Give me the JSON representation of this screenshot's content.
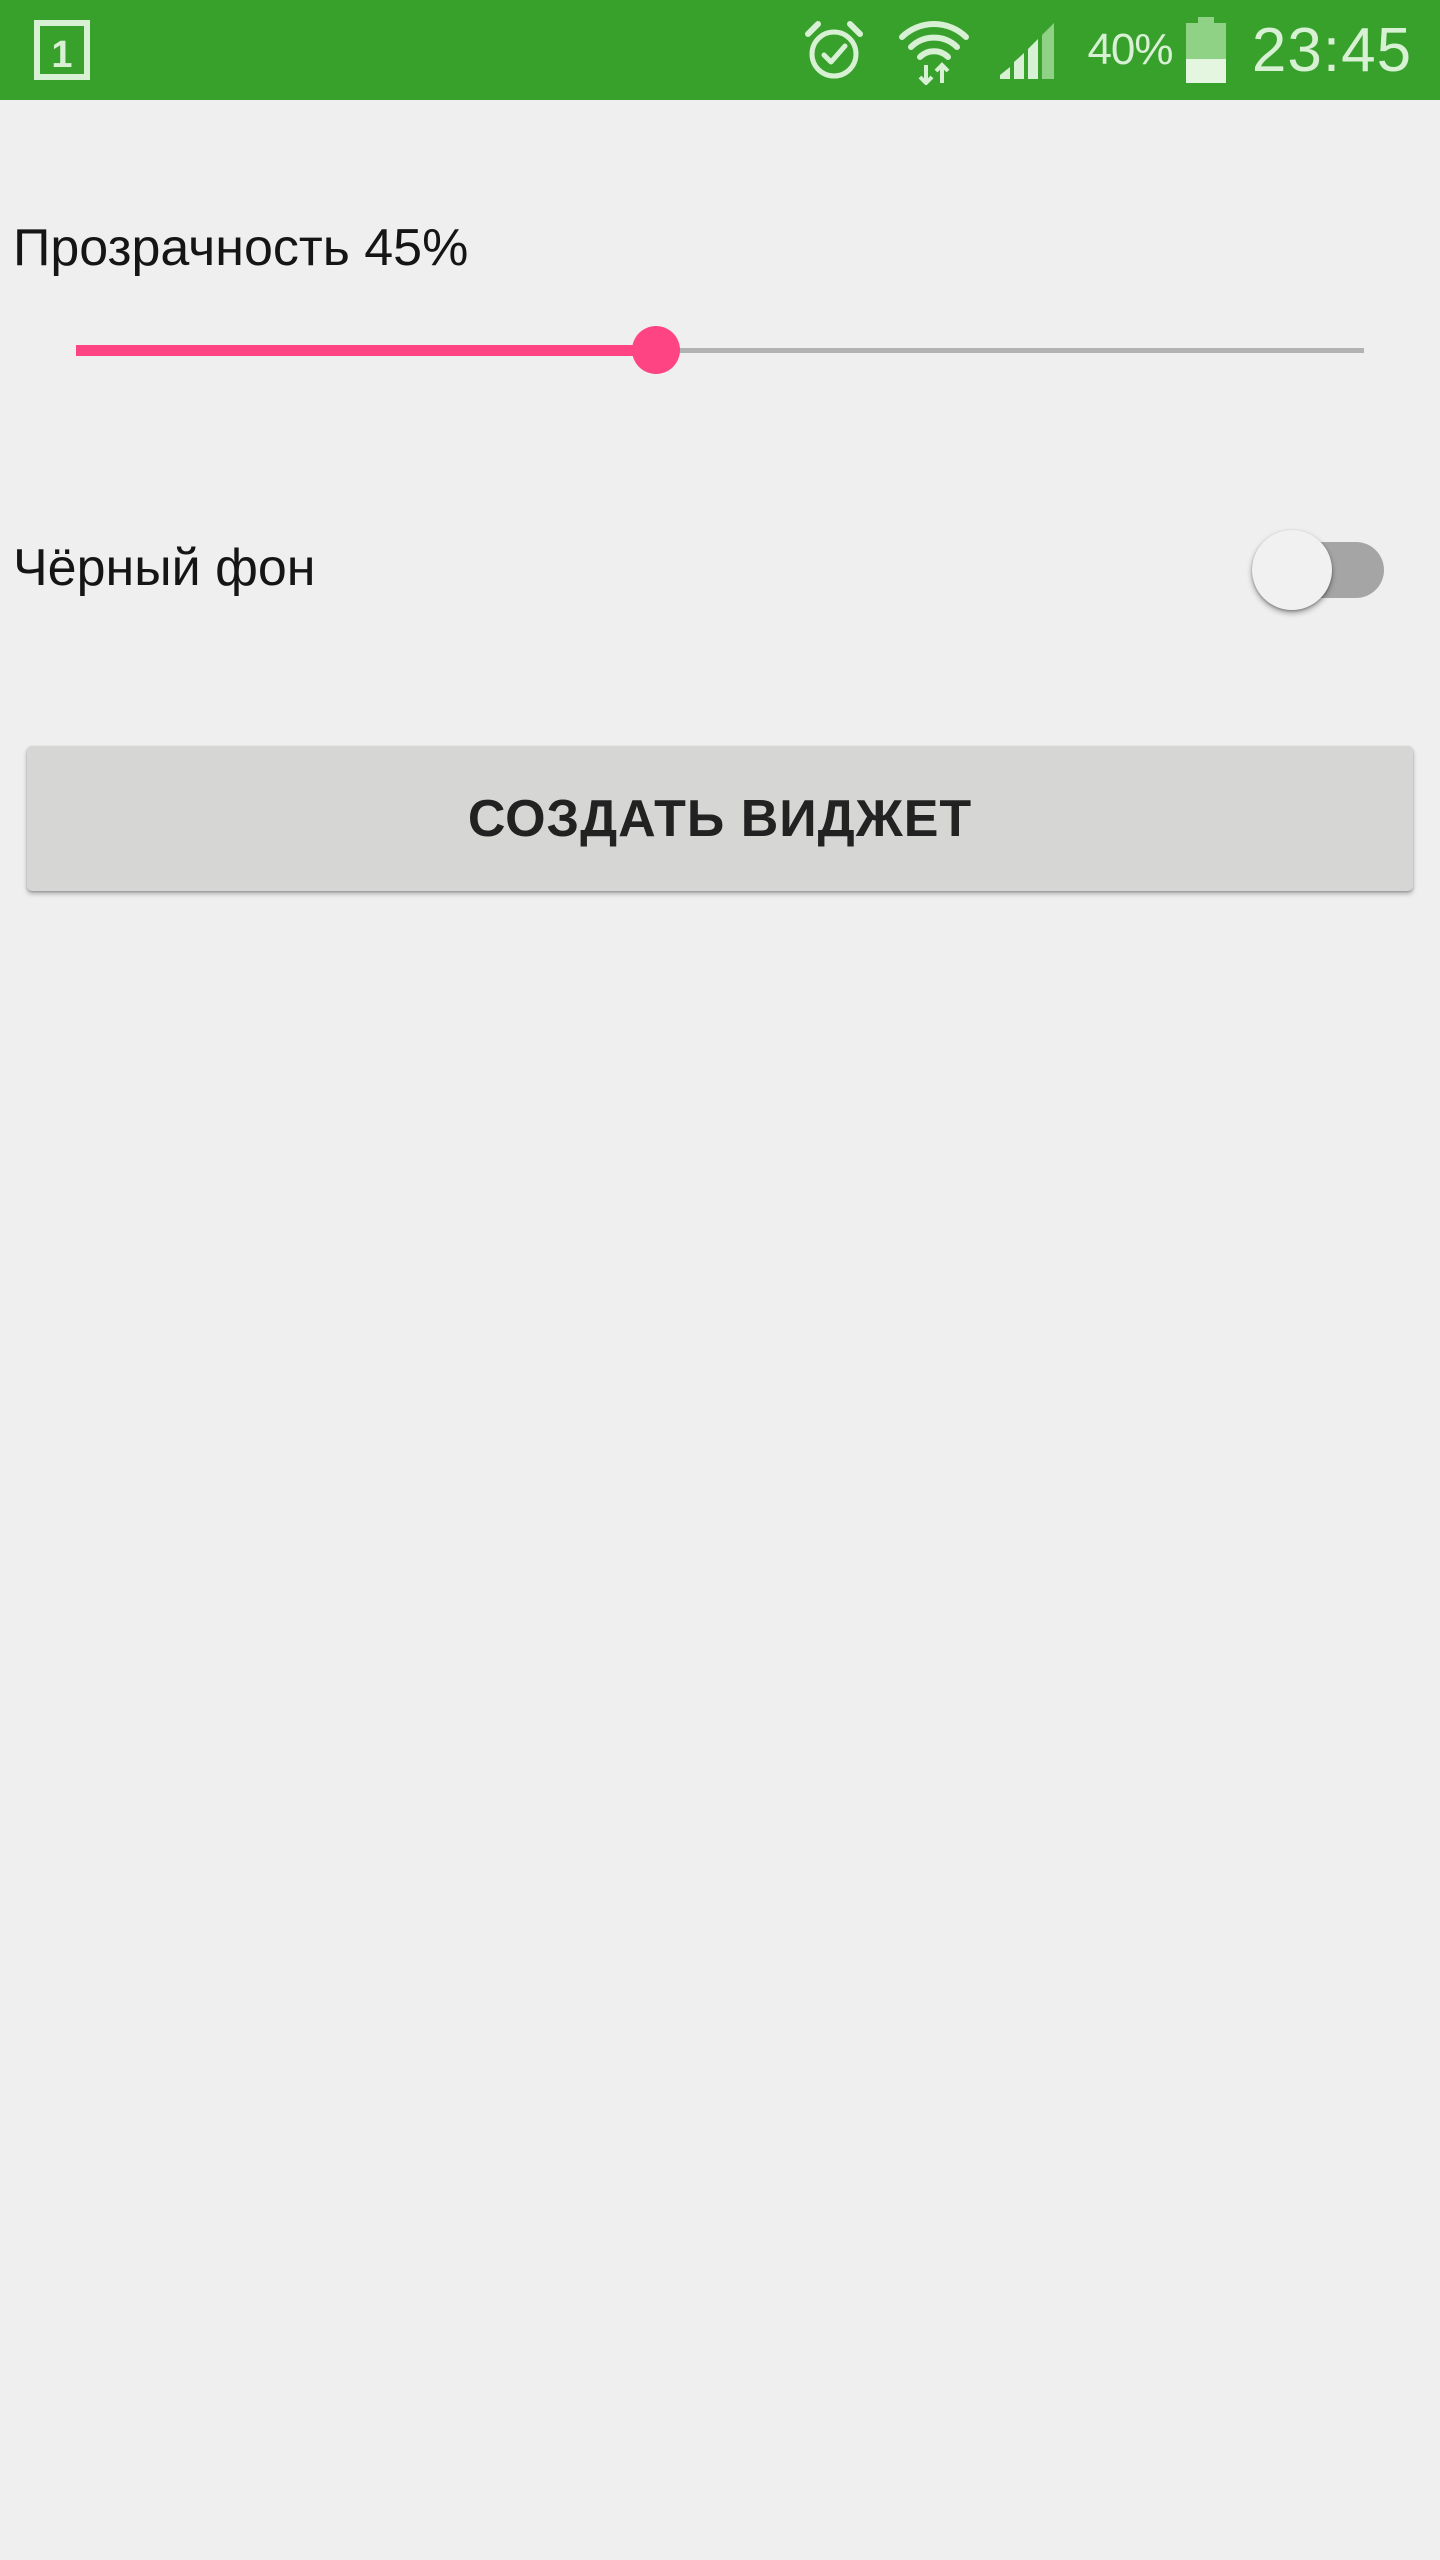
{
  "status_bar": {
    "background_color": "#37a12c",
    "icons": [
      "calendar-icon",
      "alarm-icon",
      "wifi-icon",
      "signal-icon",
      "battery-icon"
    ],
    "calendar_day": "1",
    "battery_percent": "40%",
    "battery_level": 0.4,
    "time": "23:45"
  },
  "settings": {
    "opacity": {
      "label": "Прозрачность 45%",
      "value_percent": 45,
      "accent_color": "#ff4483"
    },
    "black_background": {
      "label": "Чёрный фон",
      "enabled": false
    }
  },
  "actions": {
    "create_widget_label": "СОЗДАТЬ ВИДЖЕТ"
  }
}
